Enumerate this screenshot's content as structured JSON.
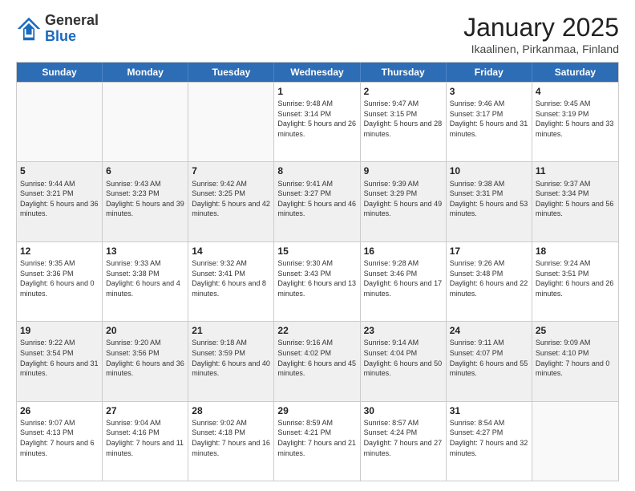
{
  "header": {
    "logo_general": "General",
    "logo_blue": "Blue",
    "month_title": "January 2025",
    "subtitle": "Ikaalinen, Pirkanmaa, Finland"
  },
  "days_of_week": [
    "Sunday",
    "Monday",
    "Tuesday",
    "Wednesday",
    "Thursday",
    "Friday",
    "Saturday"
  ],
  "weeks": [
    [
      {
        "day": "",
        "info": ""
      },
      {
        "day": "",
        "info": ""
      },
      {
        "day": "",
        "info": ""
      },
      {
        "day": "1",
        "info": "Sunrise: 9:48 AM\nSunset: 3:14 PM\nDaylight: 5 hours and 26 minutes."
      },
      {
        "day": "2",
        "info": "Sunrise: 9:47 AM\nSunset: 3:15 PM\nDaylight: 5 hours and 28 minutes."
      },
      {
        "day": "3",
        "info": "Sunrise: 9:46 AM\nSunset: 3:17 PM\nDaylight: 5 hours and 31 minutes."
      },
      {
        "day": "4",
        "info": "Sunrise: 9:45 AM\nSunset: 3:19 PM\nDaylight: 5 hours and 33 minutes."
      }
    ],
    [
      {
        "day": "5",
        "info": "Sunrise: 9:44 AM\nSunset: 3:21 PM\nDaylight: 5 hours and 36 minutes."
      },
      {
        "day": "6",
        "info": "Sunrise: 9:43 AM\nSunset: 3:23 PM\nDaylight: 5 hours and 39 minutes."
      },
      {
        "day": "7",
        "info": "Sunrise: 9:42 AM\nSunset: 3:25 PM\nDaylight: 5 hours and 42 minutes."
      },
      {
        "day": "8",
        "info": "Sunrise: 9:41 AM\nSunset: 3:27 PM\nDaylight: 5 hours and 46 minutes."
      },
      {
        "day": "9",
        "info": "Sunrise: 9:39 AM\nSunset: 3:29 PM\nDaylight: 5 hours and 49 minutes."
      },
      {
        "day": "10",
        "info": "Sunrise: 9:38 AM\nSunset: 3:31 PM\nDaylight: 5 hours and 53 minutes."
      },
      {
        "day": "11",
        "info": "Sunrise: 9:37 AM\nSunset: 3:34 PM\nDaylight: 5 hours and 56 minutes."
      }
    ],
    [
      {
        "day": "12",
        "info": "Sunrise: 9:35 AM\nSunset: 3:36 PM\nDaylight: 6 hours and 0 minutes."
      },
      {
        "day": "13",
        "info": "Sunrise: 9:33 AM\nSunset: 3:38 PM\nDaylight: 6 hours and 4 minutes."
      },
      {
        "day": "14",
        "info": "Sunrise: 9:32 AM\nSunset: 3:41 PM\nDaylight: 6 hours and 8 minutes."
      },
      {
        "day": "15",
        "info": "Sunrise: 9:30 AM\nSunset: 3:43 PM\nDaylight: 6 hours and 13 minutes."
      },
      {
        "day": "16",
        "info": "Sunrise: 9:28 AM\nSunset: 3:46 PM\nDaylight: 6 hours and 17 minutes."
      },
      {
        "day": "17",
        "info": "Sunrise: 9:26 AM\nSunset: 3:48 PM\nDaylight: 6 hours and 22 minutes."
      },
      {
        "day": "18",
        "info": "Sunrise: 9:24 AM\nSunset: 3:51 PM\nDaylight: 6 hours and 26 minutes."
      }
    ],
    [
      {
        "day": "19",
        "info": "Sunrise: 9:22 AM\nSunset: 3:54 PM\nDaylight: 6 hours and 31 minutes."
      },
      {
        "day": "20",
        "info": "Sunrise: 9:20 AM\nSunset: 3:56 PM\nDaylight: 6 hours and 36 minutes."
      },
      {
        "day": "21",
        "info": "Sunrise: 9:18 AM\nSunset: 3:59 PM\nDaylight: 6 hours and 40 minutes."
      },
      {
        "day": "22",
        "info": "Sunrise: 9:16 AM\nSunset: 4:02 PM\nDaylight: 6 hours and 45 minutes."
      },
      {
        "day": "23",
        "info": "Sunrise: 9:14 AM\nSunset: 4:04 PM\nDaylight: 6 hours and 50 minutes."
      },
      {
        "day": "24",
        "info": "Sunrise: 9:11 AM\nSunset: 4:07 PM\nDaylight: 6 hours and 55 minutes."
      },
      {
        "day": "25",
        "info": "Sunrise: 9:09 AM\nSunset: 4:10 PM\nDaylight: 7 hours and 0 minutes."
      }
    ],
    [
      {
        "day": "26",
        "info": "Sunrise: 9:07 AM\nSunset: 4:13 PM\nDaylight: 7 hours and 6 minutes."
      },
      {
        "day": "27",
        "info": "Sunrise: 9:04 AM\nSunset: 4:16 PM\nDaylight: 7 hours and 11 minutes."
      },
      {
        "day": "28",
        "info": "Sunrise: 9:02 AM\nSunset: 4:18 PM\nDaylight: 7 hours and 16 minutes."
      },
      {
        "day": "29",
        "info": "Sunrise: 8:59 AM\nSunset: 4:21 PM\nDaylight: 7 hours and 21 minutes."
      },
      {
        "day": "30",
        "info": "Sunrise: 8:57 AM\nSunset: 4:24 PM\nDaylight: 7 hours and 27 minutes."
      },
      {
        "day": "31",
        "info": "Sunrise: 8:54 AM\nSunset: 4:27 PM\nDaylight: 7 hours and 32 minutes."
      },
      {
        "day": "",
        "info": ""
      }
    ]
  ]
}
